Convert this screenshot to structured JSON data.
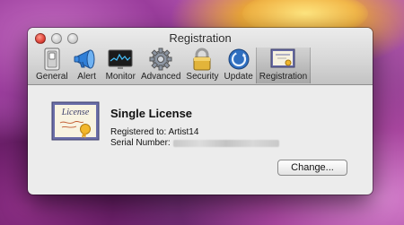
{
  "window": {
    "title": "Registration"
  },
  "toolbar": {
    "items": [
      {
        "label": "General",
        "icon": "switch-icon"
      },
      {
        "label": "Alert",
        "icon": "megaphone-icon"
      },
      {
        "label": "Monitor",
        "icon": "monitor-icon"
      },
      {
        "label": "Advanced",
        "icon": "gear-icon"
      },
      {
        "label": "Security",
        "icon": "lock-icon"
      },
      {
        "label": "Update",
        "icon": "refresh-globe-icon"
      },
      {
        "label": "Registration",
        "icon": "certificate-icon",
        "selected": true
      }
    ]
  },
  "license": {
    "certificate_word": "License",
    "heading": "Single License",
    "registered_to": "Registered to: Artist14",
    "serial_label": "Serial Number:",
    "change_button": "Change..."
  }
}
